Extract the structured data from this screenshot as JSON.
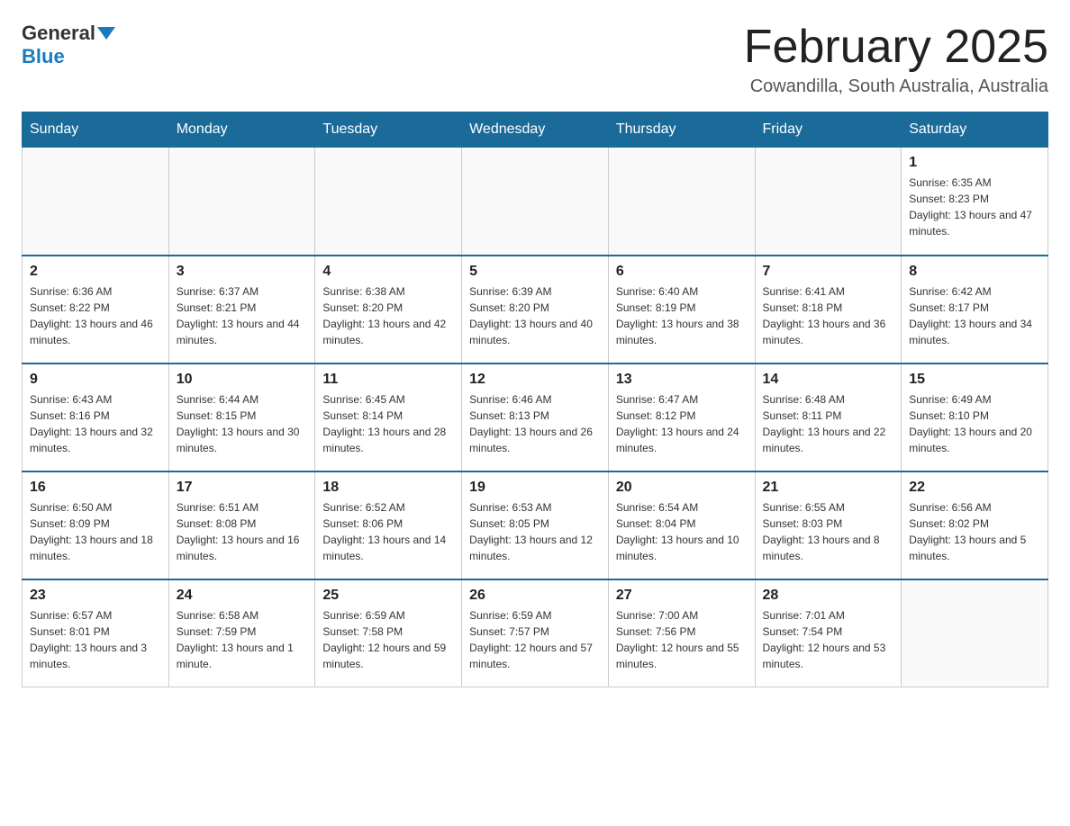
{
  "header": {
    "logo_general": "General",
    "logo_blue": "Blue",
    "title": "February 2025",
    "subtitle": "Cowandilla, South Australia, Australia"
  },
  "days_of_week": [
    "Sunday",
    "Monday",
    "Tuesday",
    "Wednesday",
    "Thursday",
    "Friday",
    "Saturday"
  ],
  "weeks": [
    [
      {
        "day": "",
        "info": ""
      },
      {
        "day": "",
        "info": ""
      },
      {
        "day": "",
        "info": ""
      },
      {
        "day": "",
        "info": ""
      },
      {
        "day": "",
        "info": ""
      },
      {
        "day": "",
        "info": ""
      },
      {
        "day": "1",
        "info": "Sunrise: 6:35 AM\nSunset: 8:23 PM\nDaylight: 13 hours and 47 minutes."
      }
    ],
    [
      {
        "day": "2",
        "info": "Sunrise: 6:36 AM\nSunset: 8:22 PM\nDaylight: 13 hours and 46 minutes."
      },
      {
        "day": "3",
        "info": "Sunrise: 6:37 AM\nSunset: 8:21 PM\nDaylight: 13 hours and 44 minutes."
      },
      {
        "day": "4",
        "info": "Sunrise: 6:38 AM\nSunset: 8:20 PM\nDaylight: 13 hours and 42 minutes."
      },
      {
        "day": "5",
        "info": "Sunrise: 6:39 AM\nSunset: 8:20 PM\nDaylight: 13 hours and 40 minutes."
      },
      {
        "day": "6",
        "info": "Sunrise: 6:40 AM\nSunset: 8:19 PM\nDaylight: 13 hours and 38 minutes."
      },
      {
        "day": "7",
        "info": "Sunrise: 6:41 AM\nSunset: 8:18 PM\nDaylight: 13 hours and 36 minutes."
      },
      {
        "day": "8",
        "info": "Sunrise: 6:42 AM\nSunset: 8:17 PM\nDaylight: 13 hours and 34 minutes."
      }
    ],
    [
      {
        "day": "9",
        "info": "Sunrise: 6:43 AM\nSunset: 8:16 PM\nDaylight: 13 hours and 32 minutes."
      },
      {
        "day": "10",
        "info": "Sunrise: 6:44 AM\nSunset: 8:15 PM\nDaylight: 13 hours and 30 minutes."
      },
      {
        "day": "11",
        "info": "Sunrise: 6:45 AM\nSunset: 8:14 PM\nDaylight: 13 hours and 28 minutes."
      },
      {
        "day": "12",
        "info": "Sunrise: 6:46 AM\nSunset: 8:13 PM\nDaylight: 13 hours and 26 minutes."
      },
      {
        "day": "13",
        "info": "Sunrise: 6:47 AM\nSunset: 8:12 PM\nDaylight: 13 hours and 24 minutes."
      },
      {
        "day": "14",
        "info": "Sunrise: 6:48 AM\nSunset: 8:11 PM\nDaylight: 13 hours and 22 minutes."
      },
      {
        "day": "15",
        "info": "Sunrise: 6:49 AM\nSunset: 8:10 PM\nDaylight: 13 hours and 20 minutes."
      }
    ],
    [
      {
        "day": "16",
        "info": "Sunrise: 6:50 AM\nSunset: 8:09 PM\nDaylight: 13 hours and 18 minutes."
      },
      {
        "day": "17",
        "info": "Sunrise: 6:51 AM\nSunset: 8:08 PM\nDaylight: 13 hours and 16 minutes."
      },
      {
        "day": "18",
        "info": "Sunrise: 6:52 AM\nSunset: 8:06 PM\nDaylight: 13 hours and 14 minutes."
      },
      {
        "day": "19",
        "info": "Sunrise: 6:53 AM\nSunset: 8:05 PM\nDaylight: 13 hours and 12 minutes."
      },
      {
        "day": "20",
        "info": "Sunrise: 6:54 AM\nSunset: 8:04 PM\nDaylight: 13 hours and 10 minutes."
      },
      {
        "day": "21",
        "info": "Sunrise: 6:55 AM\nSunset: 8:03 PM\nDaylight: 13 hours and 8 minutes."
      },
      {
        "day": "22",
        "info": "Sunrise: 6:56 AM\nSunset: 8:02 PM\nDaylight: 13 hours and 5 minutes."
      }
    ],
    [
      {
        "day": "23",
        "info": "Sunrise: 6:57 AM\nSunset: 8:01 PM\nDaylight: 13 hours and 3 minutes."
      },
      {
        "day": "24",
        "info": "Sunrise: 6:58 AM\nSunset: 7:59 PM\nDaylight: 13 hours and 1 minute."
      },
      {
        "day": "25",
        "info": "Sunrise: 6:59 AM\nSunset: 7:58 PM\nDaylight: 12 hours and 59 minutes."
      },
      {
        "day": "26",
        "info": "Sunrise: 6:59 AM\nSunset: 7:57 PM\nDaylight: 12 hours and 57 minutes."
      },
      {
        "day": "27",
        "info": "Sunrise: 7:00 AM\nSunset: 7:56 PM\nDaylight: 12 hours and 55 minutes."
      },
      {
        "day": "28",
        "info": "Sunrise: 7:01 AM\nSunset: 7:54 PM\nDaylight: 12 hours and 53 minutes."
      },
      {
        "day": "",
        "info": ""
      }
    ]
  ]
}
